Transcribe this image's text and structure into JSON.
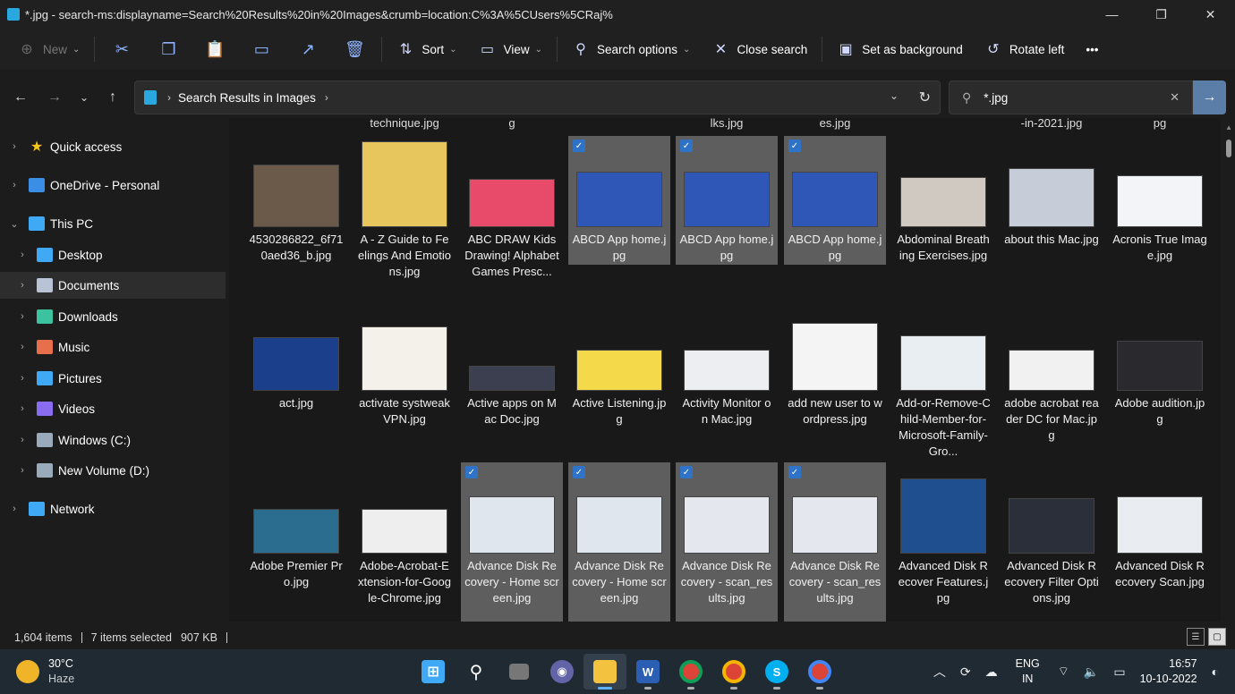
{
  "window": {
    "title": "*.jpg - search-ms:displayname=Search%20Results%20in%20Images&crumb=location:C%3A%5CUsers%5CRaj%",
    "controls": [
      "—",
      "❐",
      "✕"
    ]
  },
  "toolbar": {
    "new_label": "New",
    "sort_label": "Sort",
    "view_label": "View",
    "search_options_label": "Search options",
    "close_search_label": "Close search",
    "set_background_label": "Set as background",
    "rotate_left_label": "Rotate left",
    "more_label": "•••"
  },
  "address": {
    "crumb": "Search Results in Images"
  },
  "search": {
    "value": "*.jpg"
  },
  "sidebar": {
    "items": [
      {
        "label": "Quick access",
        "icon": "star-icon",
        "color": "#f5c518"
      },
      {
        "label": "OneDrive - Personal",
        "icon": "cloud-icon",
        "color": "#3a8ee6"
      },
      {
        "label": "This PC",
        "icon": "computer-icon",
        "color": "#3fa9f5"
      },
      {
        "label": "Desktop",
        "icon": "desktop-icon",
        "color": "#3fa9f5"
      },
      {
        "label": "Documents",
        "icon": "document-icon",
        "color": "#b8c4d6"
      },
      {
        "label": "Downloads",
        "icon": "download-icon",
        "color": "#3bc3a0"
      },
      {
        "label": "Music",
        "icon": "music-icon",
        "color": "#e86f4c"
      },
      {
        "label": "Pictures",
        "icon": "pictures-icon",
        "color": "#3fa9f5"
      },
      {
        "label": "Videos",
        "icon": "videos-icon",
        "color": "#8a6cf0"
      },
      {
        "label": "Windows (C:)",
        "icon": "drive-icon",
        "color": "#9ab"
      },
      {
        "label": "New Volume (D:)",
        "icon": "drive-icon",
        "color": "#9ab"
      },
      {
        "label": "Network",
        "icon": "network-icon",
        "color": "#3fa9f5"
      }
    ]
  },
  "partial_row": [
    "technique.jpg",
    "g",
    "lks.jpg",
    "es.jpg",
    "-in-2021.jpg",
    "pg"
  ],
  "files": [
    {
      "name": "4530286822_6f710aed36_b.jpg",
      "selected": false,
      "thumb_color": "#6b5a4a"
    },
    {
      "name": "A - Z Guide to Feelings And Emotions.jpg",
      "selected": false,
      "thumb_color": "#e7c65e"
    },
    {
      "name": "ABC DRAW Kids Drawing! Alphabet Games Presc...",
      "selected": false,
      "thumb_color": "#e84a6a"
    },
    {
      "name": "ABCD App home.jpg",
      "selected": true,
      "thumb_color": "#2f57b8"
    },
    {
      "name": "ABCD App home.jpg",
      "selected": true,
      "thumb_color": "#2f57b8"
    },
    {
      "name": "ABCD App home.jpg",
      "selected": true,
      "thumb_color": "#2f57b8"
    },
    {
      "name": "Abdominal Breathing Exercises.jpg",
      "selected": false,
      "thumb_color": "#cfc9c2"
    },
    {
      "name": "about this Mac.jpg",
      "selected": false,
      "thumb_color": "#c7cdd8"
    },
    {
      "name": "Acronis True Image.jpg",
      "selected": false,
      "thumb_color": "#f2f4f7"
    },
    {
      "name": "act.jpg",
      "selected": false,
      "thumb_color": "#1b3f8a"
    },
    {
      "name": "activate systweak VPN.jpg",
      "selected": false,
      "thumb_color": "#f3f1ea"
    },
    {
      "name": "Active apps on Mac Doc.jpg",
      "selected": false,
      "thumb_color": "#3b3f50"
    },
    {
      "name": "Active Listening.jpg",
      "selected": false,
      "thumb_color": "#f4d94a"
    },
    {
      "name": "Activity Monitor on Mac.jpg",
      "selected": false,
      "thumb_color": "#eceef2"
    },
    {
      "name": "add new user to wordpress.jpg",
      "selected": false,
      "thumb_color": "#f4f4f4"
    },
    {
      "name": "Add-or-Remove-Child-Member-for-Microsoft-Family-Gro...",
      "selected": false,
      "thumb_color": "#e9eef3"
    },
    {
      "name": "adobe acrobat reader DC for Mac.jpg",
      "selected": false,
      "thumb_color": "#f1f1f1"
    },
    {
      "name": "Adobe audition.jpg",
      "selected": false,
      "thumb_color": "#2a2a2e"
    },
    {
      "name": "Adobe Premier Pro.jpg",
      "selected": false,
      "thumb_color": "#2b6d8f"
    },
    {
      "name": "Adobe-Acrobat-Extension-for-Google-Chrome.jpg",
      "selected": false,
      "thumb_color": "#eeeeee"
    },
    {
      "name": "Advance Disk Recovery - Home screen.jpg",
      "selected": true,
      "thumb_color": "#dfe6ee"
    },
    {
      "name": "Advance Disk Recovery - Home screen.jpg",
      "selected": true,
      "thumb_color": "#dfe6ee"
    },
    {
      "name": "Advance Disk Recovery - scan_results.jpg",
      "selected": true,
      "thumb_color": "#e4e8ee"
    },
    {
      "name": "Advance Disk Recovery - scan_results.jpg",
      "selected": true,
      "thumb_color": "#e4e8ee"
    },
    {
      "name": "Advanced Disk Recover Features.jpg",
      "selected": false,
      "thumb_color": "#1f4f8f"
    },
    {
      "name": "Advanced Disk Recovery Filter Options.jpg",
      "selected": false,
      "thumb_color": "#2a2f3a"
    },
    {
      "name": "Advanced Disk Recovery Scan.jpg",
      "selected": false,
      "thumb_color": "#e9edf2"
    }
  ],
  "status": {
    "item_count": "1,604 items",
    "selection": "7 items selected",
    "size": "907 KB"
  },
  "taskbar": {
    "temperature": "30°C",
    "condition": "Haze",
    "language": "ENG",
    "region": "IN",
    "time": "16:57",
    "date": "10-10-2022"
  }
}
